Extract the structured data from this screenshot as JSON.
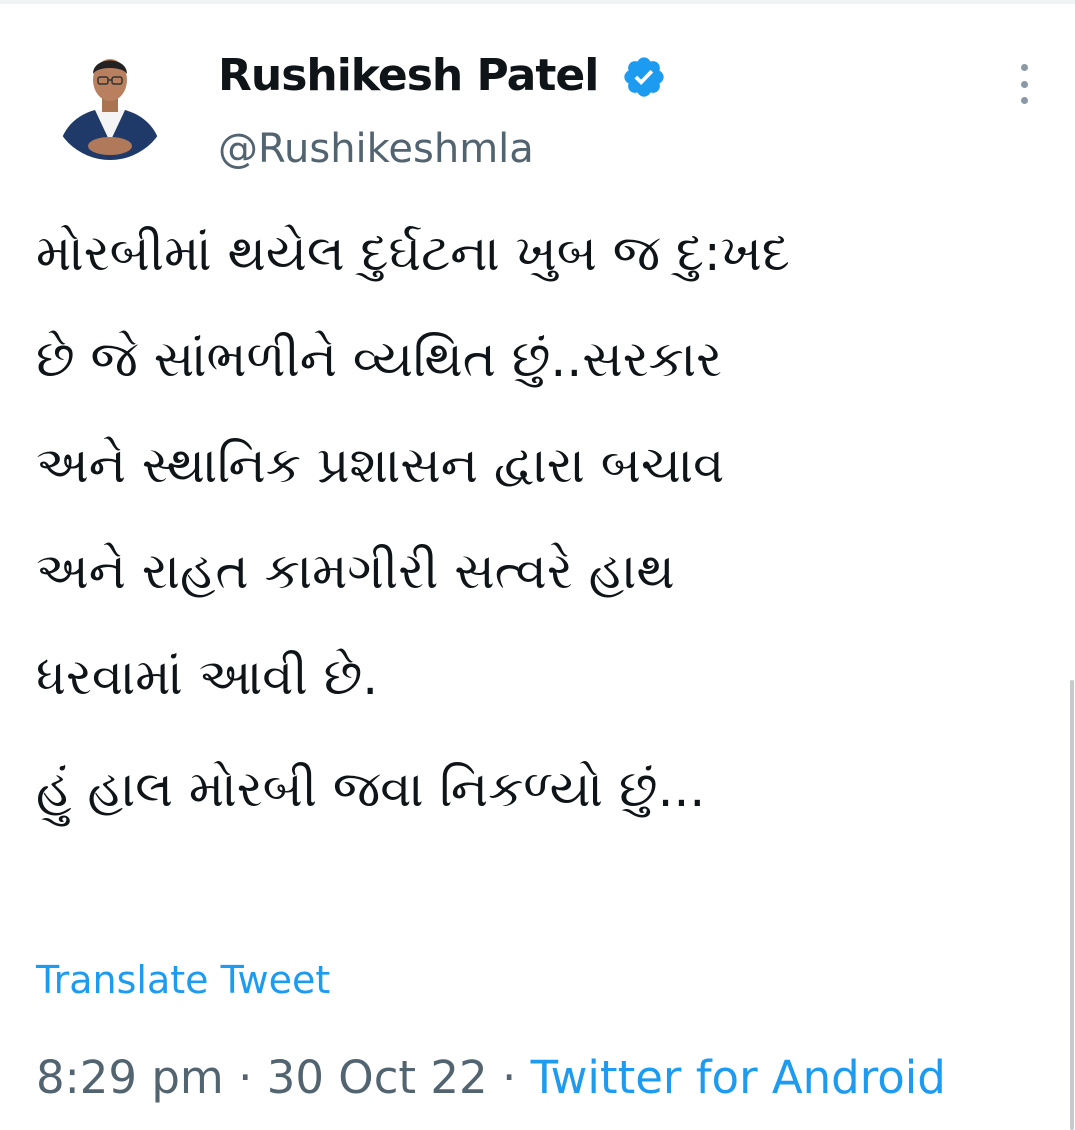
{
  "tweet": {
    "author": {
      "display_name": "Rushikesh Patel",
      "handle": "@Rushikeshmla",
      "verified": true,
      "verified_icon": "verified-badge-icon",
      "avatar": "profile-photo"
    },
    "more_icon": "more-options-icon",
    "text_lines": [
      "મોરબીમાં થયેલ દુર્ઘટના ખુબ જ દુ:ખદ",
      "છે જે સાંભળીને વ્યથિત છું..સરકાર",
      "અને સ્થાનિક પ્રશાસન દ્વારા બચાવ",
      "અને રાહત કામગીરી સત્વરે હાથ",
      "ધરવામાં આવી છે."
    ],
    "text_line_last": "હું હાલ મોરબી જવા નિકળ્યો છું...",
    "translate_label": "Translate Tweet",
    "time": "8:29 pm",
    "date": "30 Oct 22",
    "separator": "·",
    "source": "Twitter for Android"
  },
  "colors": {
    "text": "#0f1419",
    "secondary": "#536471",
    "accent": "#1d9bf0"
  }
}
